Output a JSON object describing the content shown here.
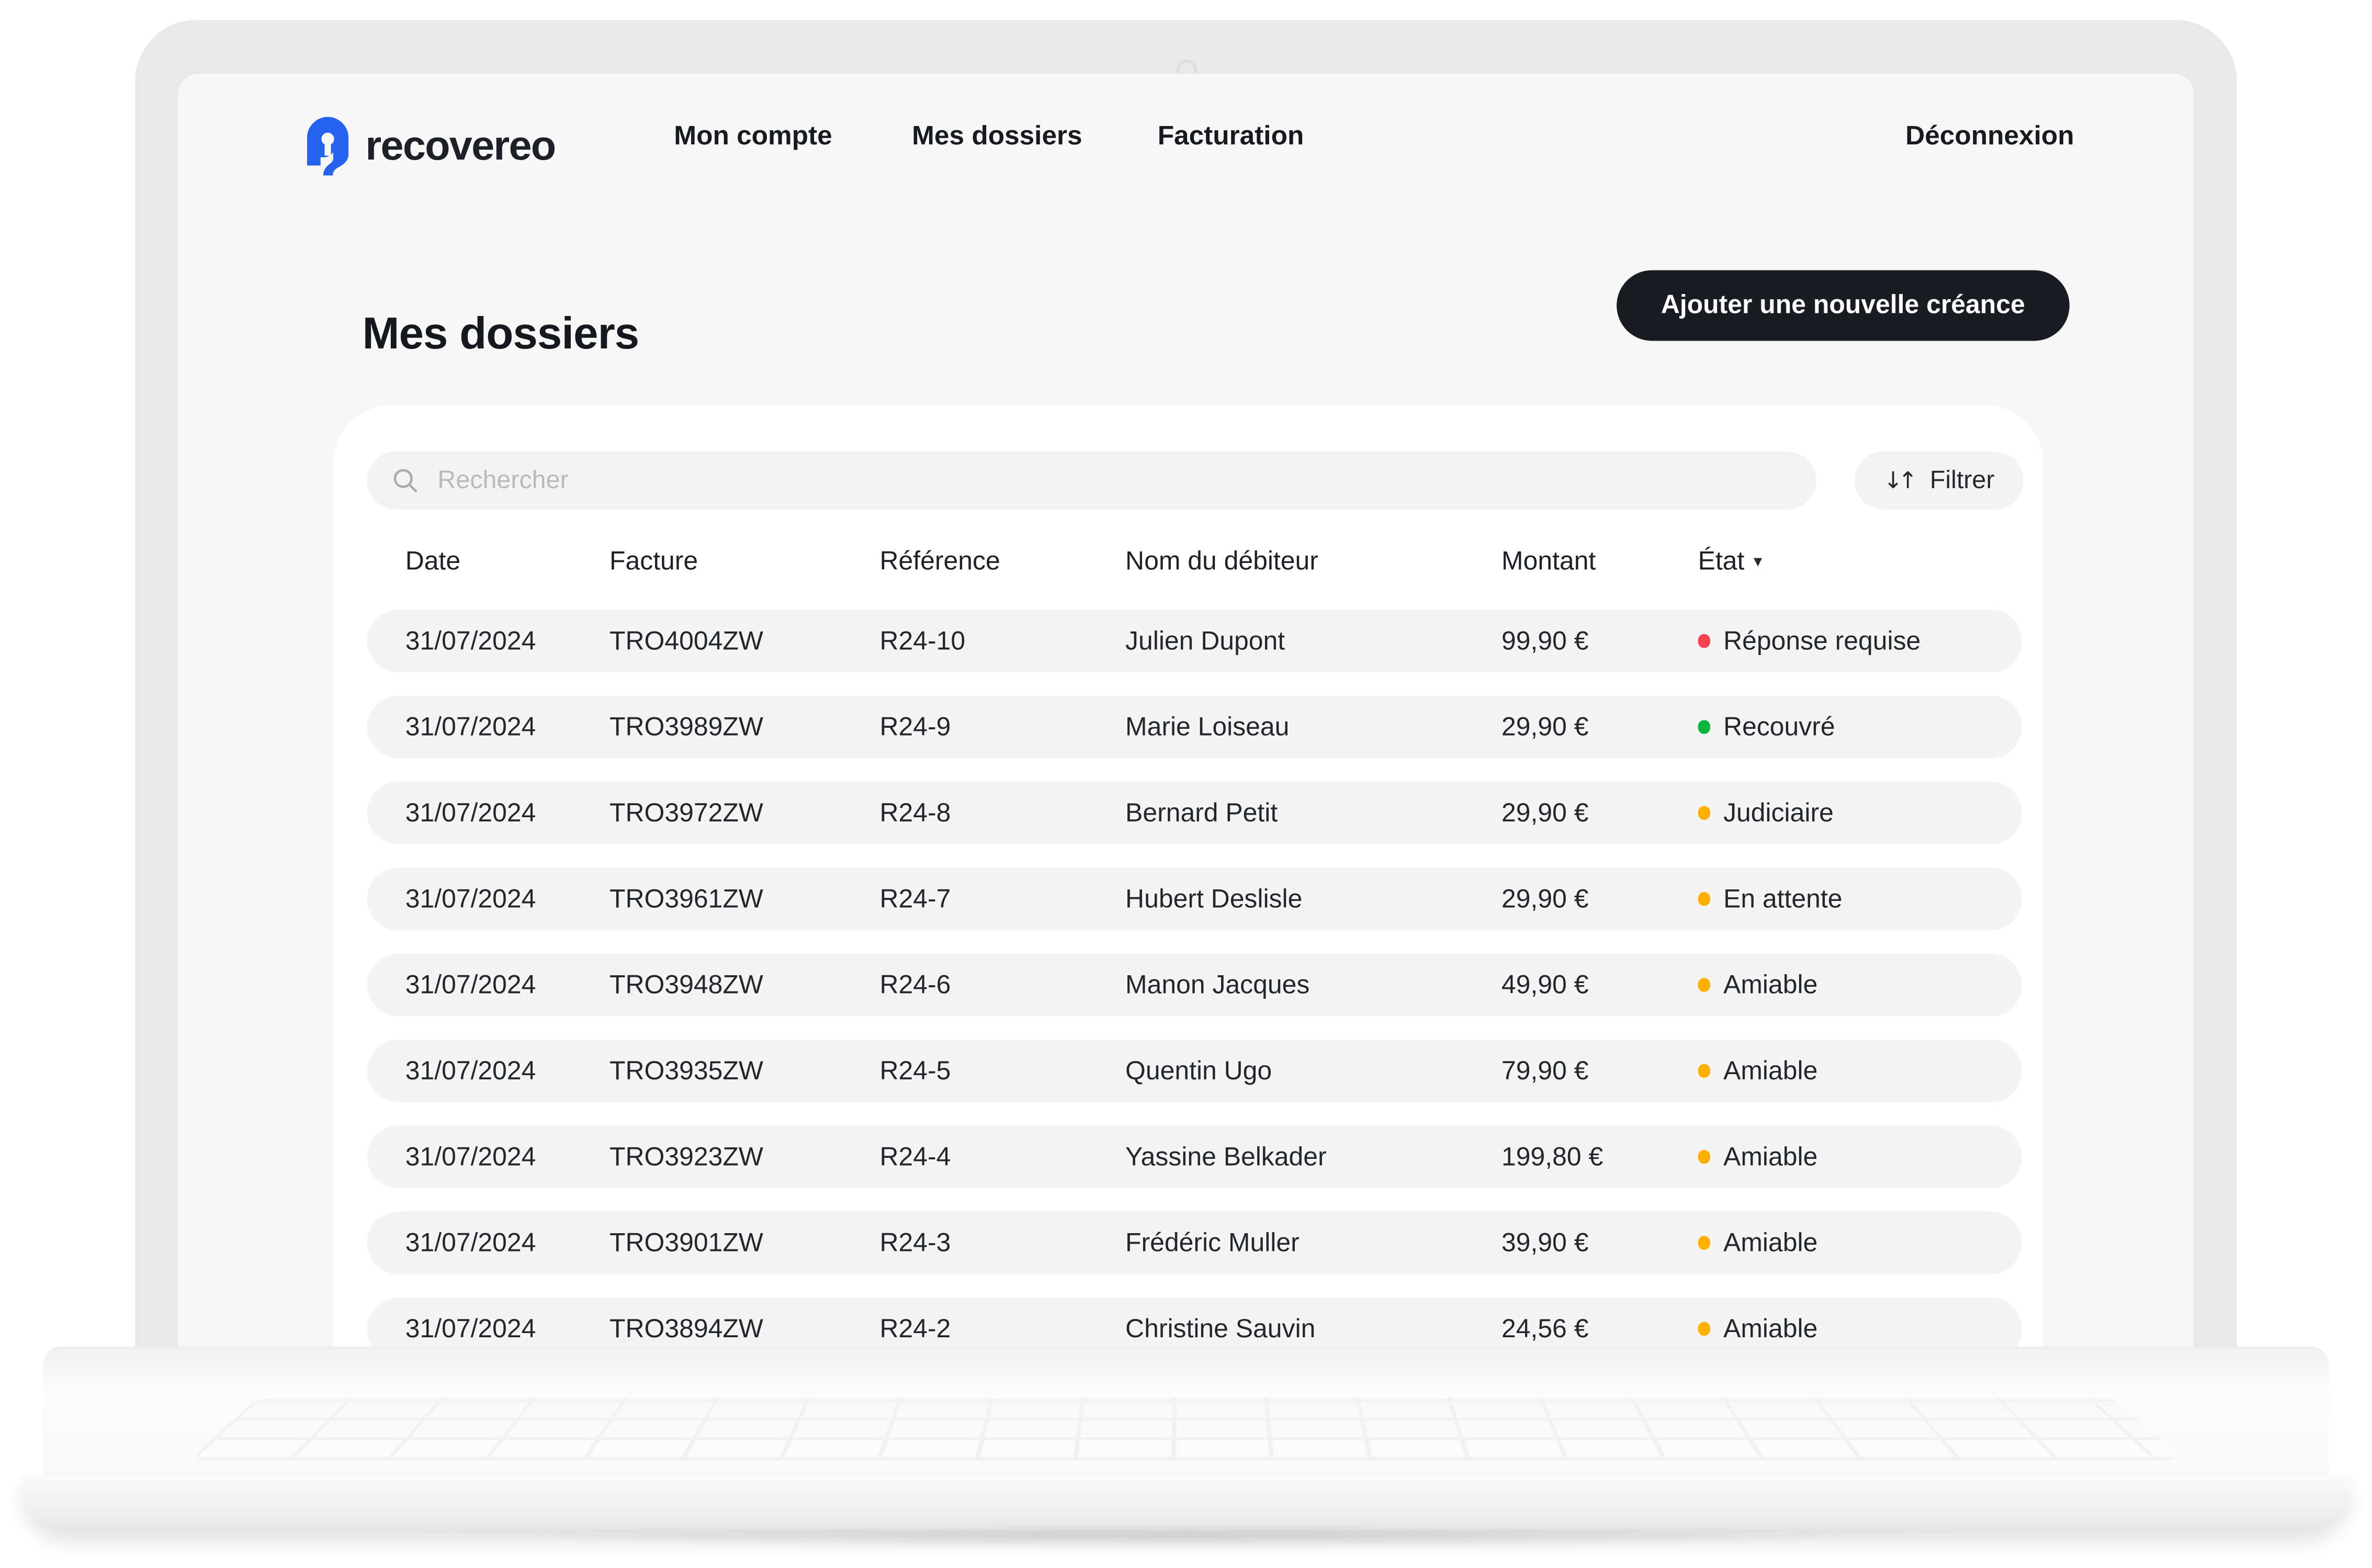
{
  "nav": {
    "brand": "recovereo",
    "items": [
      {
        "label": "Mon compte"
      },
      {
        "label": "Mes dossiers"
      },
      {
        "label": "Facturation"
      }
    ],
    "logout_label": "Déconnexion"
  },
  "page": {
    "title": "Mes dossiers",
    "add_button_label": "Ajouter une nouvelle créance"
  },
  "toolbar": {
    "search_placeholder": "Rechercher",
    "filter_label": "Filtrer",
    "filter_icon": "↓↑",
    "sort_icon": "▾"
  },
  "table": {
    "headers": [
      "Date",
      "Facture",
      "Référence",
      "Nom du débiteur",
      "Montant",
      "État"
    ],
    "rows": [
      {
        "date": "31/07/2024",
        "invoice": "TRO4004ZW",
        "reference": "R24-10",
        "debtor": "Julien Dupont",
        "amount": "99,90 €",
        "status": "Réponse requise",
        "status_type": "danger"
      },
      {
        "date": "31/07/2024",
        "invoice": "TRO3989ZW",
        "reference": "R24-9",
        "debtor": "Marie Loiseau",
        "amount": "29,90 €",
        "status": "Recouvré",
        "status_type": "success"
      },
      {
        "date": "31/07/2024",
        "invoice": "TRO3972ZW",
        "reference": "R24-8",
        "debtor": "Bernard Petit",
        "amount": "29,90 €",
        "status": "Judiciaire",
        "status_type": "warning"
      },
      {
        "date": "31/07/2024",
        "invoice": "TRO3961ZW",
        "reference": "R24-7",
        "debtor": "Hubert Deslisle",
        "amount": "29,90 €",
        "status": "En attente",
        "status_type": "warning"
      },
      {
        "date": "31/07/2024",
        "invoice": "TRO3948ZW",
        "reference": "R24-6",
        "debtor": "Manon Jacques",
        "amount": "49,90 €",
        "status": "Amiable",
        "status_type": "warning"
      },
      {
        "date": "31/07/2024",
        "invoice": "TRO3935ZW",
        "reference": "R24-5",
        "debtor": "Quentin Ugo",
        "amount": "79,90 €",
        "status": "Amiable",
        "status_type": "warning"
      },
      {
        "date": "31/07/2024",
        "invoice": "TRO3923ZW",
        "reference": "R24-4",
        "debtor": "Yassine Belkader",
        "amount": "199,80 €",
        "status": "Amiable",
        "status_type": "warning"
      },
      {
        "date": "31/07/2024",
        "invoice": "TRO3901ZW",
        "reference": "R24-3",
        "debtor": "Frédéric Muller",
        "amount": "39,90 €",
        "status": "Amiable",
        "status_type": "warning"
      },
      {
        "date": "31/07/2024",
        "invoice": "TRO3894ZW",
        "reference": "R24-2",
        "debtor": "Christine Sauvin",
        "amount": "24,56 €",
        "status": "Amiable",
        "status_type": "warning"
      }
    ]
  },
  "colors": {
    "accent_blue": "#2562ef",
    "danger": "#f9424f",
    "success": "#0ab53c",
    "warning": "#ffb002",
    "button_bg": "#191d22"
  }
}
